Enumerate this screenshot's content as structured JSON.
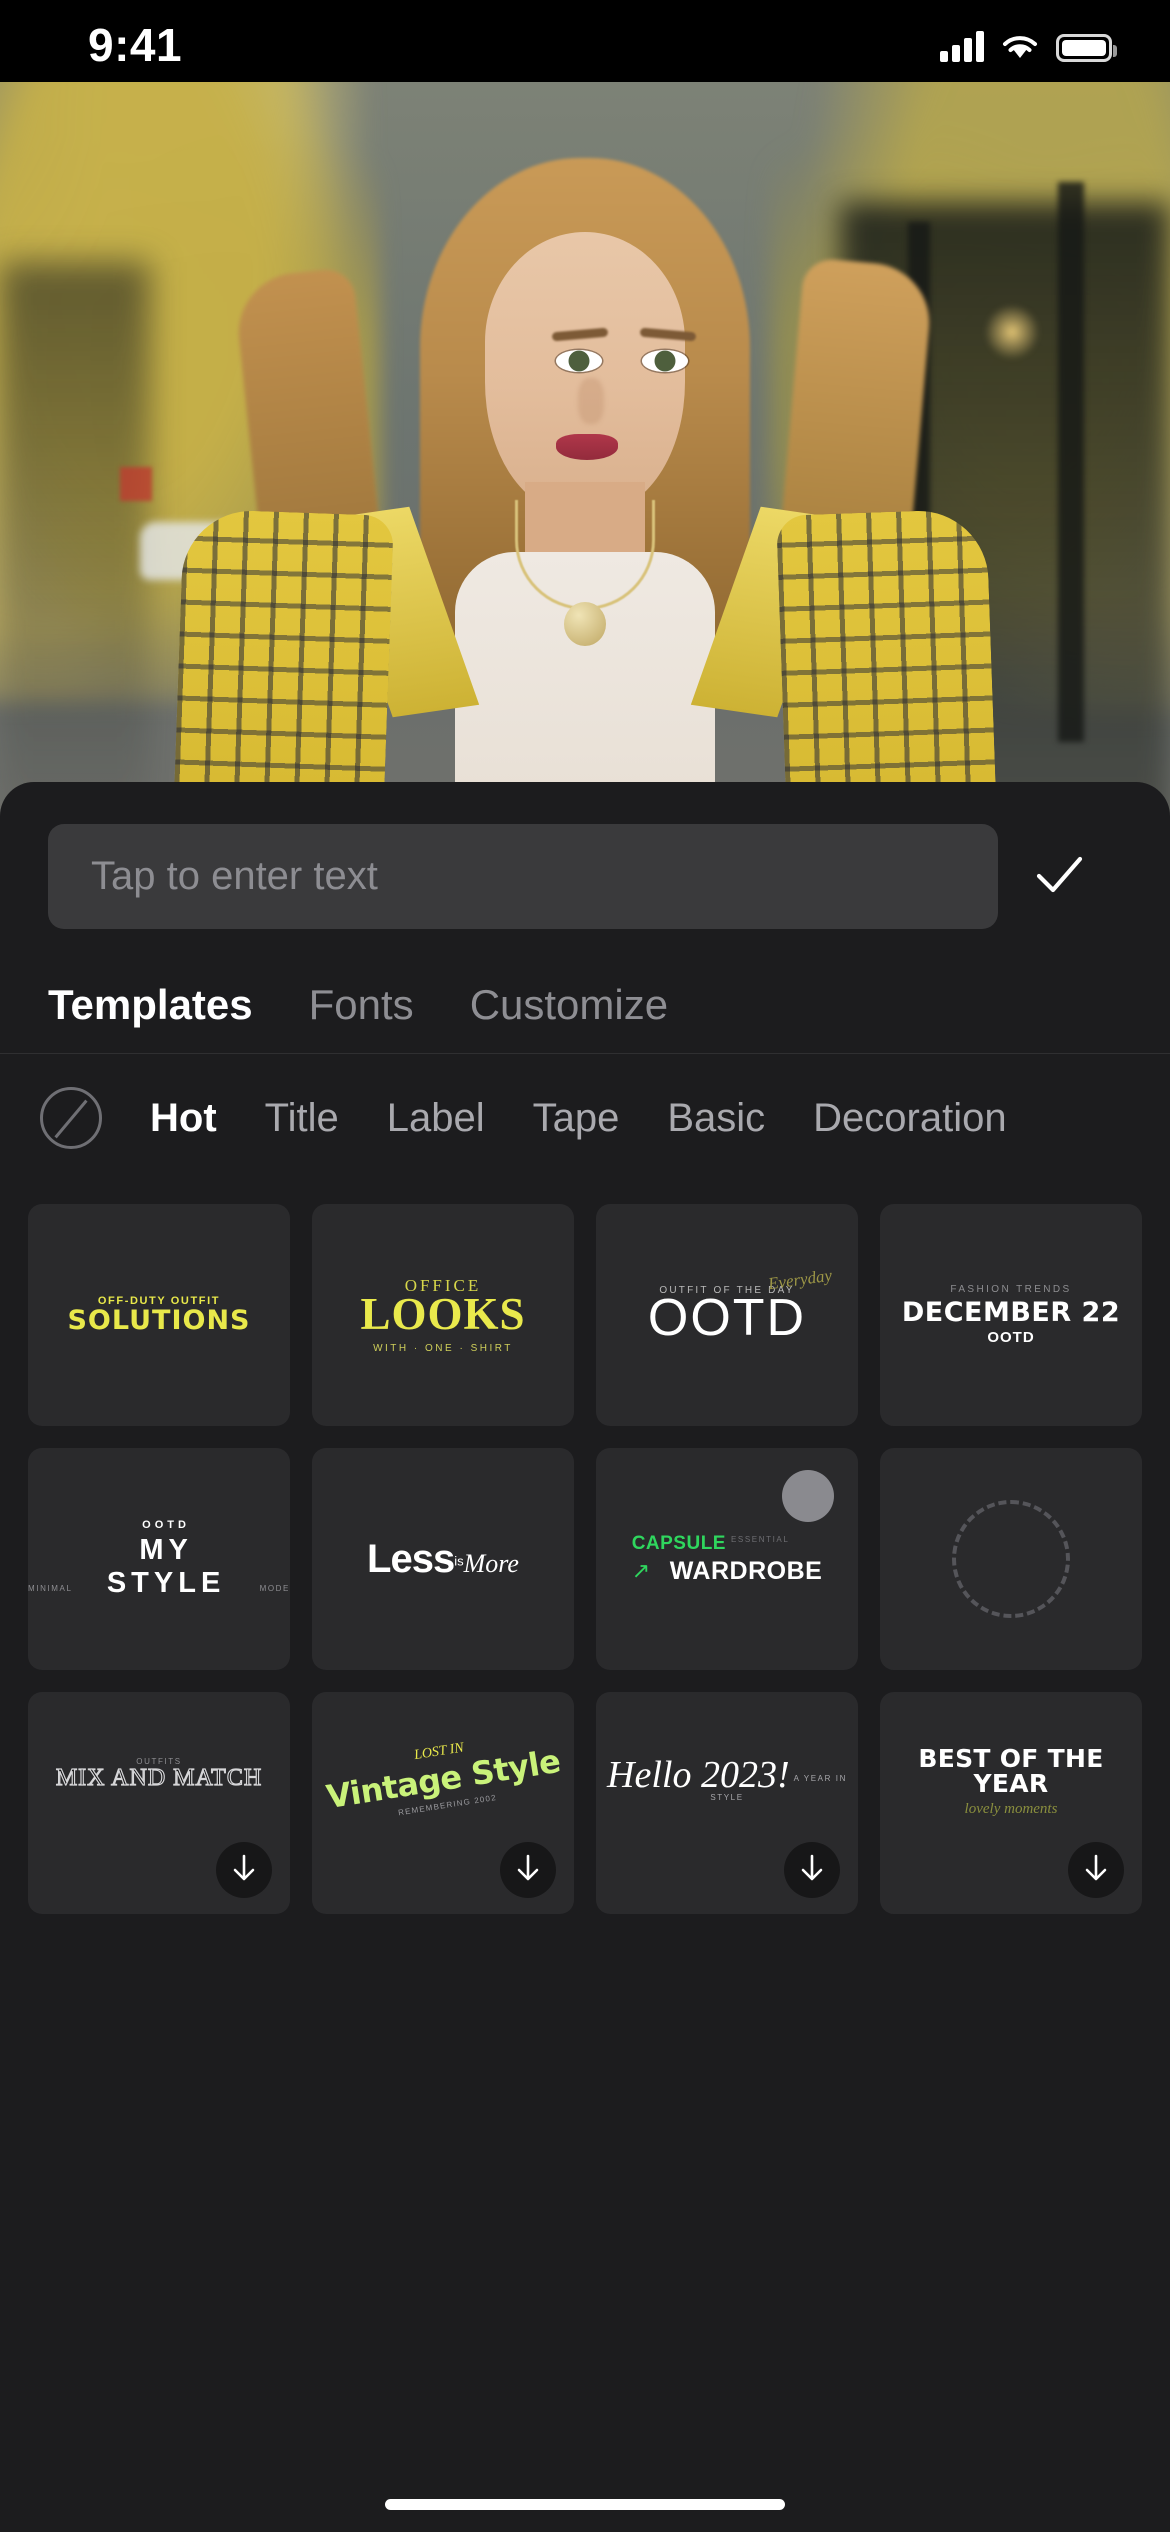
{
  "status_bar": {
    "time": "9:41",
    "signal_icon": "cellular-signal-icon",
    "wifi_icon": "wifi-icon",
    "battery_icon": "battery-icon"
  },
  "canvas": {
    "undo_label": "undo-icon",
    "redo_label": "redo-icon"
  },
  "text_input": {
    "placeholder": "Tap to enter text",
    "value": "",
    "confirm_icon": "checkmark-icon"
  },
  "tabs": [
    {
      "label": "Templates",
      "active": true
    },
    {
      "label": "Fonts",
      "active": false
    },
    {
      "label": "Customize",
      "active": false
    }
  ],
  "categories": {
    "none_icon": "no-template-icon",
    "items": [
      {
        "label": "Hot",
        "active": true
      },
      {
        "label": "Title",
        "active": false
      },
      {
        "label": "Label",
        "active": false
      },
      {
        "label": "Tape",
        "active": false
      },
      {
        "label": "Basic",
        "active": false
      },
      {
        "label": "Decoration",
        "active": false
      }
    ]
  },
  "colors": {
    "accent_yellow": "#e8e84a",
    "accent_green": "#2fd65e",
    "vintage_green": "#c9f27a",
    "sheet_bg": "#1c1c1e",
    "card_bg": "#2a2a2c",
    "active_text": "#ffffff",
    "inactive_text": "#8e8e93"
  },
  "templates": [
    {
      "id": "solutions",
      "kicker": "OFF-DUTY OUTFIT",
      "title": "SOLUTIONS",
      "downloaded": true
    },
    {
      "id": "office-looks",
      "kicker": "OFFICE",
      "title": "LOOKS",
      "subtitle": "WITH  ·  ONE  ·  SHIRT",
      "downloaded": true
    },
    {
      "id": "ootd",
      "kicker": "OUTFIT OF THE DAY",
      "title": "OOTD",
      "script": "Everyday",
      "downloaded": true
    },
    {
      "id": "december-22",
      "kicker": "FASHION TRENDS",
      "title": "DECEMBER 22",
      "subtitle": "OOTD",
      "downloaded": true
    },
    {
      "id": "my-style",
      "left_tag": "MINIMAL",
      "kicker": "OOTD",
      "title": "MY  STYLE",
      "right_tag": "MODE",
      "downloaded": true
    },
    {
      "id": "less-is-more",
      "title": "Less",
      "mid": "is",
      "tail": "More",
      "downloaded": true
    },
    {
      "id": "capsule-wardrobe",
      "title": "CAPSULE",
      "sub_tag": "ESSENTIAL",
      "title2": "WARDROBE",
      "arrow_icon": "arrow-up-right-icon",
      "loading": true
    },
    {
      "id": "placeholder-dashed",
      "placeholder_icon": "dashed-circle-icon"
    },
    {
      "id": "mix-and-match",
      "kicker": "OUTFITS",
      "title": "MIX AND MATCH",
      "download_icon": "download-icon"
    },
    {
      "id": "vintage-style",
      "kicker": "LOST IN",
      "title": "Vintage Style",
      "subtitle": "REMEMBERING 2002",
      "download_icon": "download-icon"
    },
    {
      "id": "hello-2023",
      "title": "Hello 2023!",
      "kicker": "A YEAR IN STYLE",
      "download_icon": "download-icon"
    },
    {
      "id": "best-of-the-year",
      "title": "BEST OF THE YEAR",
      "subtitle": "lovely moments",
      "download_icon": "download-icon"
    }
  ],
  "home_indicator": "home-indicator"
}
